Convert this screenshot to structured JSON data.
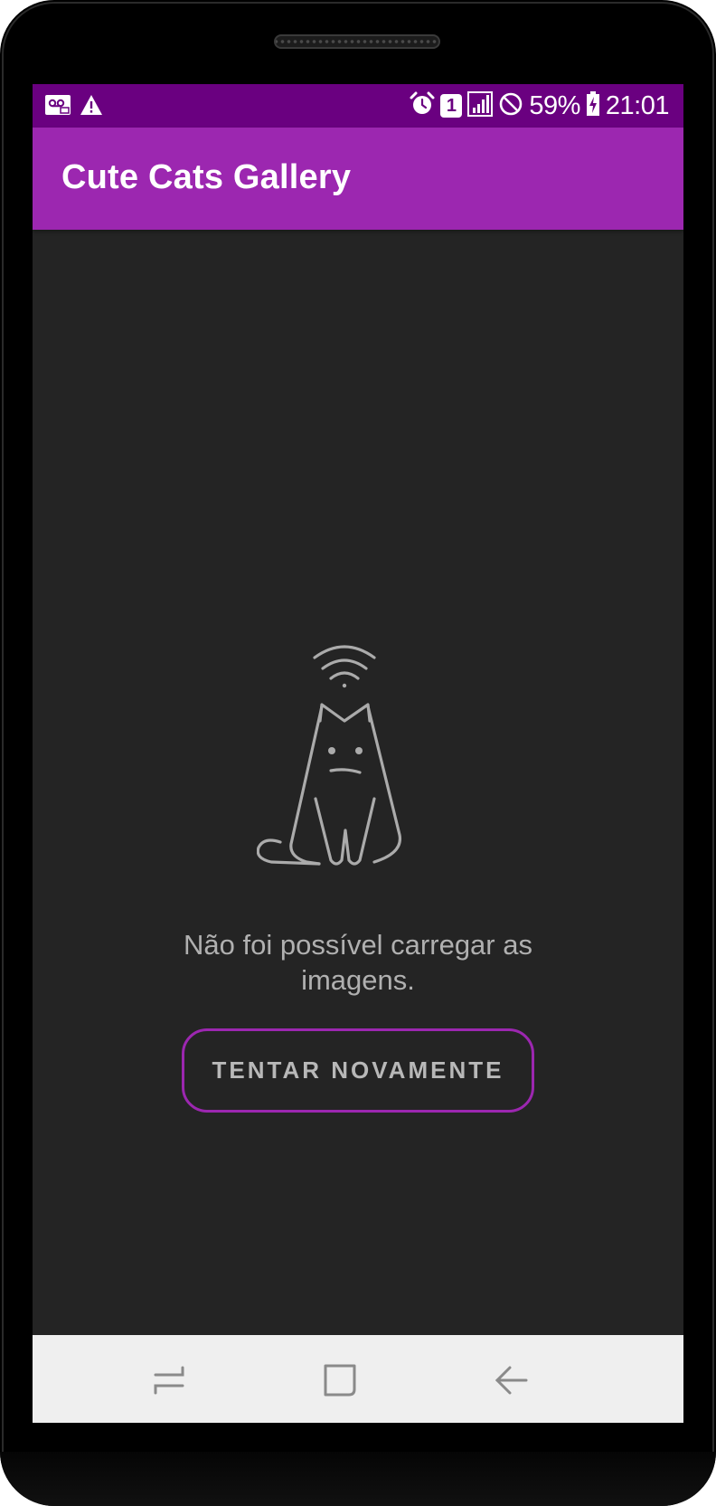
{
  "status_bar": {
    "left_icons": [
      "voicemail-icon",
      "warning-icon"
    ],
    "sim_badge": "1",
    "battery_percent": "59%",
    "time": "21:01"
  },
  "app_bar": {
    "title": "Cute Cats Gallery"
  },
  "empty_state": {
    "illustration": "sad-cat-no-signal",
    "message": "Não foi possível carregar as imagens.",
    "retry_label": "TENTAR NOVAMENTE"
  },
  "nav_bar": {
    "items": [
      "recent-apps",
      "home",
      "back"
    ]
  },
  "colors": {
    "status_bar": "#6a0080",
    "app_bar": "#9c27b0",
    "background": "#242424",
    "nav_bar": "#efefef",
    "accent": "#9c27b0"
  }
}
